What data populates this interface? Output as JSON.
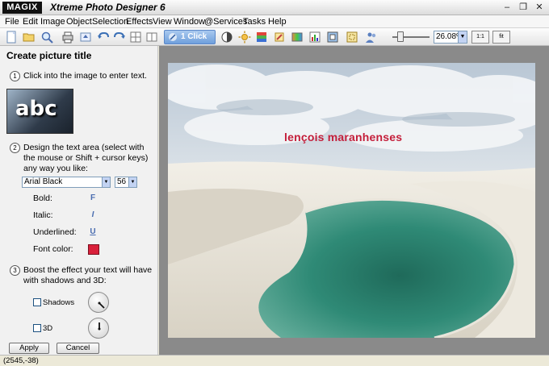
{
  "app": {
    "logo": "MAGIX",
    "title": "Xtreme Photo Designer 6"
  },
  "window_controls": {
    "minimize": "–",
    "maximize": "❐",
    "close": "✕"
  },
  "menu": [
    "File",
    "Edit",
    "Image",
    "Object",
    "Selection",
    "Effects",
    "View",
    "Window",
    "@Services",
    "Tasks",
    "Help"
  ],
  "toolbar": {
    "one_click_label": "1 Click",
    "zoom_value": "26.08%",
    "zoom_fit_1_label": "1:1",
    "zoom_fit_label": "fit"
  },
  "panel": {
    "title": "Create picture title",
    "step1": {
      "num": "1",
      "text": "Click into the image to enter text."
    },
    "thumb_text": "abc",
    "step2": {
      "num": "2",
      "text": "Design the text area (select with the mouse or Shift + cursor keys) any way you like:"
    },
    "font": "Arial Black",
    "font_size": "56",
    "bold_label": "Bold:",
    "bold_glyph": "F",
    "italic_label": "Italic:",
    "italic_glyph": "I",
    "underlined_label": "Underlined:",
    "underlined_glyph": "U",
    "font_color_label": "Font color:",
    "font_color": "#d9203a",
    "step3": {
      "num": "3",
      "text": "Boost the effect your text will have with shadows and 3D:"
    },
    "shadows_label": "Shadows",
    "threed_label": "3D",
    "apply_label": "Apply",
    "cancel_label": "Cancel"
  },
  "canvas": {
    "overlay_text": "lençois maranhenses",
    "overlay_color": "#c41e3a"
  },
  "status": {
    "coords": "(2545,-38)"
  }
}
